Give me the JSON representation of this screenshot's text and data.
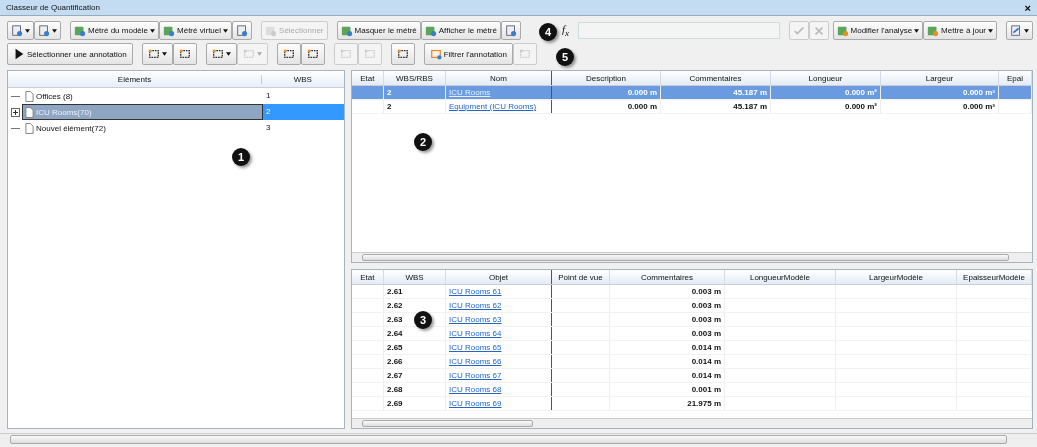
{
  "window": {
    "title": "Classeur de Quantification",
    "close": "×"
  },
  "toolbar_rows": [
    [
      [
        {
          "kind": "icon",
          "dropdown": true,
          "disabled": false
        },
        {
          "kind": "icon",
          "dropdown": true,
          "disabled": false
        }
      ],
      [
        {
          "kind": "text",
          "label": "Métré du modèle",
          "dropdown": true,
          "disabled": false
        },
        {
          "kind": "text",
          "label": "Métré virtuel",
          "dropdown": true,
          "disabled": false
        },
        {
          "kind": "icon",
          "dropdown": false,
          "disabled": false
        }
      ],
      [
        {
          "kind": "text",
          "label": "Sélectionner",
          "dropdown": false,
          "disabled": true
        }
      ],
      [
        {
          "kind": "text",
          "label": "Masquer le métré",
          "dropdown": false,
          "disabled": false
        },
        {
          "kind": "text",
          "label": "Afficher le métré",
          "dropdown": false,
          "disabled": false
        },
        {
          "kind": "icon",
          "dropdown": false,
          "disabled": false
        }
      ]
    ],
    [
      [
        {
          "kind": "arrow",
          "label": "Sélectionner une annotation",
          "dropdown": false,
          "disabled": false
        }
      ],
      [
        {
          "kind": "icon",
          "dropdown": true,
          "disabled": false
        },
        {
          "kind": "icon",
          "dropdown": false,
          "disabled": false
        }
      ],
      [
        {
          "kind": "icon",
          "dropdown": true,
          "disabled": false
        },
        {
          "kind": "icon",
          "dropdown": true,
          "disabled": true
        }
      ],
      [
        {
          "kind": "icon",
          "dropdown": false,
          "disabled": false
        },
        {
          "kind": "icon",
          "dropdown": false,
          "disabled": false
        }
      ],
      [
        {
          "kind": "icon",
          "dropdown": false,
          "disabled": true
        },
        {
          "kind": "icon",
          "dropdown": false,
          "disabled": true
        }
      ],
      [
        {
          "kind": "icon",
          "dropdown": false,
          "disabled": false
        }
      ],
      [
        {
          "kind": "text",
          "label": "Filtrer l'annotation",
          "dropdown": false,
          "disabled": false
        },
        {
          "kind": "icon",
          "dropdown": false,
          "disabled": true
        }
      ]
    ]
  ],
  "formula": {
    "label": "f$_{x}$",
    "confirm_disabled": true,
    "cancel_disabled": true
  },
  "right_tools": [
    [
      {
        "kind": "text",
        "label": "Modifier l'analyse",
        "dropdown": true,
        "disabled": false
      },
      {
        "kind": "text",
        "label": "Mettre à jour",
        "dropdown": true,
        "disabled": false
      }
    ],
    [
      {
        "kind": "icon",
        "dropdown": true,
        "disabled": false
      }
    ]
  ],
  "tree": {
    "columns": [
      "Eléments",
      "WBS"
    ],
    "items": [
      {
        "label": "Offices (8)",
        "wbs": "1",
        "selected": false,
        "expandable": false
      },
      {
        "label": "ICU Rooms(70)",
        "wbs": "2",
        "selected": true,
        "expandable": true
      },
      {
        "label": "Nouvel élément(72)",
        "wbs": "3",
        "selected": false,
        "expandable": false
      }
    ]
  },
  "top_table": {
    "columns": [
      "Etat",
      "WBS/RBS",
      "Nom",
      "Description",
      "Commentaires",
      "Longueur",
      "Largeur",
      "Epai"
    ],
    "rows": [
      {
        "selected": true,
        "wbs": "2",
        "name": "ICU Rooms",
        "values": [
          "0.000 m",
          "45.187 m",
          "0.000 m²",
          "0.000 m³"
        ]
      },
      {
        "selected": false,
        "wbs": "2",
        "name": "Equipment (ICU Rooms)",
        "values": [
          "0.000 m",
          "45.187 m",
          "0.000 m²",
          "0.000 m³"
        ]
      }
    ]
  },
  "bottom_table": {
    "columns": [
      "Etat",
      "WBS",
      "Objet",
      "Point de vue",
      "Commentaires",
      "LongueurModèle",
      "LargeurModèle",
      "EpaisseurModèle"
    ],
    "rows": [
      {
        "wbs": "2.61",
        "name": "ICU Rooms 61",
        "comment": "0.003 m"
      },
      {
        "wbs": "2.62",
        "name": "ICU Rooms 62",
        "comment": "0.003 m"
      },
      {
        "wbs": "2.63",
        "name": "ICU Rooms 63",
        "comment": "0.003 m"
      },
      {
        "wbs": "2.64",
        "name": "ICU Rooms 64",
        "comment": "0.003 m"
      },
      {
        "wbs": "2.65",
        "name": "ICU Rooms 65",
        "comment": "0.014 m"
      },
      {
        "wbs": "2.66",
        "name": "ICU Rooms 66",
        "comment": "0.014 m"
      },
      {
        "wbs": "2.67",
        "name": "ICU Rooms 67",
        "comment": "0.014 m"
      },
      {
        "wbs": "2.68",
        "name": "ICU Rooms 68",
        "comment": "0.001 m"
      },
      {
        "wbs": "2.69",
        "name": "ICU Rooms 69",
        "comment": "21.975 m"
      }
    ]
  },
  "callouts": [
    "1",
    "2",
    "3",
    "4",
    "5"
  ]
}
